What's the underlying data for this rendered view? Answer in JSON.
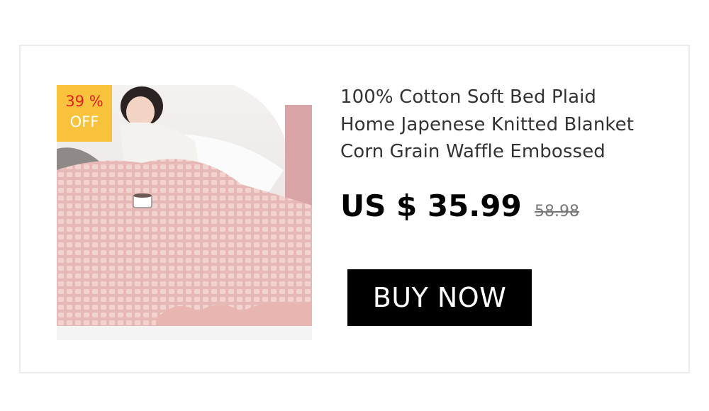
{
  "product": {
    "title_lines": [
      "100% Cotton Soft Bed Plaid",
      "Home Japenese Knitted Blanket",
      "Corn Grain Waffle Embossed"
    ],
    "price": "US $ 35.99",
    "original_price": "58.98",
    "discount": {
      "percent_label": "39 %",
      "off_label": "OFF"
    },
    "image_icon": "product-photo"
  },
  "cta": {
    "label": "BUY NOW"
  },
  "colors": {
    "badge_background": "#f9c23c",
    "badge_percent": "#e02020",
    "badge_off": "#ffffff",
    "button_background": "#000000",
    "button_text": "#ffffff",
    "title_text": "#333333",
    "price_text": "#000000",
    "old_price_text": "#777777"
  }
}
